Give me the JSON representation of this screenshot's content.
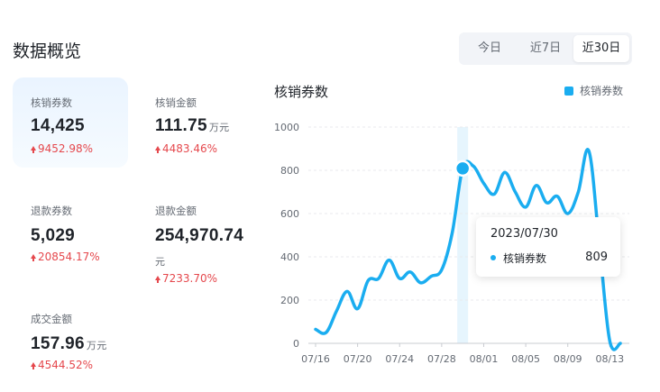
{
  "page": {
    "title": "数据概览"
  },
  "range_tabs": [
    {
      "label": "今日",
      "active": false
    },
    {
      "label": "近7日",
      "active": false
    },
    {
      "label": "近30日",
      "active": true
    }
  ],
  "metrics": {
    "redeemed_count": {
      "label": "核销券数",
      "value": "14,425",
      "unit": "",
      "change": "9452.98%"
    },
    "redeemed_amount": {
      "label": "核销金额",
      "value": "111.75",
      "unit": "万元",
      "change": "4483.46%"
    },
    "refund_count": {
      "label": "退款券数",
      "value": "5,029",
      "unit": "",
      "change": "20854.17%"
    },
    "refund_amount": {
      "label": "退款金额",
      "value": "254,970.74",
      "unit": "元",
      "change": "7233.70%"
    },
    "deal_amount": {
      "label": "成交金额",
      "value": "157.96",
      "unit": "万元",
      "change": "4544.52%"
    }
  },
  "colors": {
    "accent": "#1aadf0",
    "up": "#e5484d"
  },
  "tooltip": {
    "date": "2023/07/30",
    "series_name": "核销券数",
    "value": "809"
  },
  "chart_data": {
    "type": "line",
    "title": "核销券数",
    "legend": [
      "核销券数"
    ],
    "legend_position": "top-right",
    "x_tick_labels": [
      "07/16",
      "07/20",
      "07/24",
      "07/28",
      "08/01",
      "08/05",
      "08/09",
      "08/13"
    ],
    "x": [
      "07/16",
      "07/17",
      "07/18",
      "07/19",
      "07/20",
      "07/21",
      "07/22",
      "07/23",
      "07/24",
      "07/25",
      "07/26",
      "07/27",
      "07/28",
      "07/29",
      "07/30",
      "07/31",
      "08/01",
      "08/02",
      "08/03",
      "08/04",
      "08/05",
      "08/06",
      "08/07",
      "08/08",
      "08/09",
      "08/10",
      "08/11",
      "08/12",
      "08/13",
      "08/14"
    ],
    "ylim": [
      0,
      1000
    ],
    "yticks": [
      0,
      200,
      400,
      600,
      800,
      1000
    ],
    "grid": true,
    "series": [
      {
        "name": "核销券数",
        "values": [
          65,
          50,
          150,
          240,
          160,
          290,
          300,
          385,
          300,
          330,
          280,
          310,
          340,
          510,
          809,
          820,
          740,
          690,
          790,
          700,
          630,
          730,
          650,
          680,
          600,
          700,
          890,
          460,
          10,
          0
        ]
      }
    ],
    "highlight_index": 14
  }
}
